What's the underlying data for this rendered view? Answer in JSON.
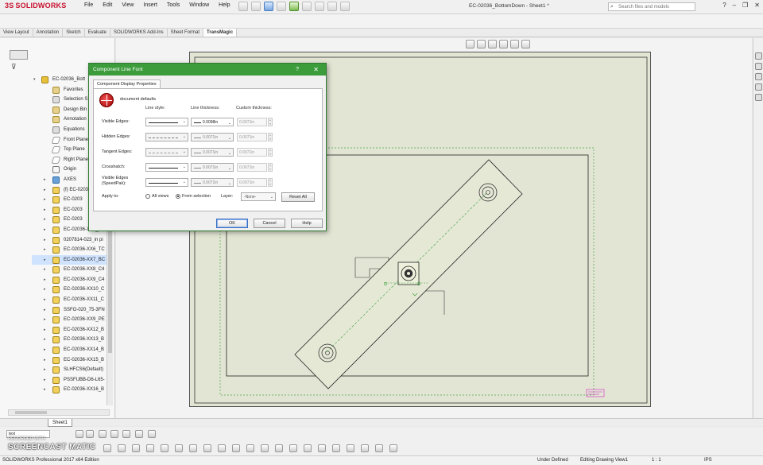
{
  "app": {
    "logo_ds": "3S",
    "logo_name": "SOLIDWORKS",
    "document_title": "EC-02036_BottomDown - Sheet1 *",
    "search_placeholder": "Search files and models",
    "help_icon": "?"
  },
  "menu": [
    "File",
    "Edit",
    "View",
    "Insert",
    "Tools",
    "Window",
    "Help"
  ],
  "command_tabs": [
    "View Layout",
    "Annotation",
    "Sketch",
    "Evaluate",
    "SOLIDWORKS Add-Ins",
    "Sheet Format",
    "TransMagic"
  ],
  "active_tab": "TransMagic",
  "feature_tree": {
    "root": "EC-02036_Bott",
    "items": [
      {
        "label": "Favorites",
        "icon": "folder-icon"
      },
      {
        "label": "Selection S",
        "icon": "selection-icon"
      },
      {
        "label": "Design Bin",
        "icon": "folder-icon"
      },
      {
        "label": "Annotation",
        "icon": "annotation-icon"
      },
      {
        "label": "Equations",
        "icon": "equations-icon"
      },
      {
        "label": "Front Plane",
        "icon": "plane-icon"
      },
      {
        "label": "Top Plane",
        "icon": "plane-icon"
      },
      {
        "label": "Right Plane",
        "icon": "plane-icon"
      },
      {
        "label": "Origin",
        "icon": "origin-icon"
      },
      {
        "label": "AXES",
        "icon": "axes-icon"
      },
      {
        "label": "(f) EC-0203",
        "icon": "part-icon"
      },
      {
        "label": "EC-0203",
        "icon": "part-icon"
      },
      {
        "label": "EC-0203",
        "icon": "part-icon"
      },
      {
        "label": "EC-0203",
        "icon": "part-icon"
      },
      {
        "label": "EC-02036-XX5_BO",
        "icon": "part-icon"
      },
      {
        "label": "0207814-023_in pi",
        "icon": "part-icon"
      },
      {
        "label": "EC-02036-XX6_TC",
        "icon": "part-icon"
      },
      {
        "label": "EC-02036-XX7_BC",
        "icon": "part-icon"
      },
      {
        "label": "EC-02036-XX8_C4",
        "icon": "part-icon"
      },
      {
        "label": "EC-02036-XX9_C4",
        "icon": "part-icon"
      },
      {
        "label": "EC-02036-XX10_C",
        "icon": "part-icon"
      },
      {
        "label": "EC-02036-XX11_C",
        "icon": "part-icon"
      },
      {
        "label": "SSFO-020_75-3FN",
        "icon": "part-icon"
      },
      {
        "label": "EC-02036-XX9_PE",
        "icon": "part-icon"
      },
      {
        "label": "EC-02036-XX12_B",
        "icon": "part-icon"
      },
      {
        "label": "EC-02036-XX13_B",
        "icon": "part-icon"
      },
      {
        "label": "EC-02036-XX14_B",
        "icon": "part-icon"
      },
      {
        "label": "EC-02036-XX15_B",
        "icon": "part-icon"
      },
      {
        "label": "SLHFCS6(Default)",
        "icon": "part-icon"
      },
      {
        "label": "PSSFUBB-D6-L65-",
        "icon": "part-icon"
      },
      {
        "label": "EC-02036-XX16_B",
        "icon": "part-icon"
      }
    ],
    "selected_index": 17
  },
  "sheet_tab": "Sheet1",
  "dialog": {
    "title": "Component Line Font",
    "help": "?",
    "close": "✕",
    "tab": "Component Display Properties",
    "document_defaults": "document defaults",
    "col_line_style": "Line style:",
    "col_line_thickness": "Line thickness:",
    "col_custom_thickness": "Custom thickness:",
    "rows": [
      {
        "label": "Visible Edges:",
        "thickness": "0.0098in",
        "custom": "0.0071in",
        "style": "solid",
        "enabled": true
      },
      {
        "label": "Hidden Edges:",
        "thickness": "0.0071in",
        "custom": "0.0071in",
        "style": "dash",
        "enabled": false
      },
      {
        "label": "Tangent Edges:",
        "thickness": "0.0071in",
        "custom": "0.0071in",
        "style": "dot",
        "enabled": false
      },
      {
        "label": "Crosshatch:",
        "thickness": "0.0071in",
        "custom": "0.0071in",
        "style": "solid",
        "enabled": true
      },
      {
        "label": "Visible Edges (SpeedPak):",
        "thickness": "0.0071in",
        "custom": "0.0071in",
        "style": "solid",
        "enabled": true
      }
    ],
    "apply_to": "Apply to:",
    "all_views": "All views",
    "from_selection": "From selection",
    "layer_label": "Layer:",
    "layer_value": "-None-",
    "reset_all": "Reset All",
    "ok": "OK",
    "cancel": "Cancel",
    "help_btn": "Help"
  },
  "bottom": {
    "layer_select": "text"
  },
  "watermark": {
    "recorded": "RECORDED WITH",
    "brand": "SCREENCAST MATIC"
  },
  "status": {
    "edition": "SOLIDWORKS Professional 2017 x64 Edition",
    "under_defined": "Under Defined",
    "editing": "Editing Drawing View1",
    "scale": "1 : 1",
    "units": "IPS"
  },
  "colors": {
    "dialog_title": "#3c9c3c",
    "sheet_bg": "#e3e5d4",
    "logo": "#c8102e"
  }
}
